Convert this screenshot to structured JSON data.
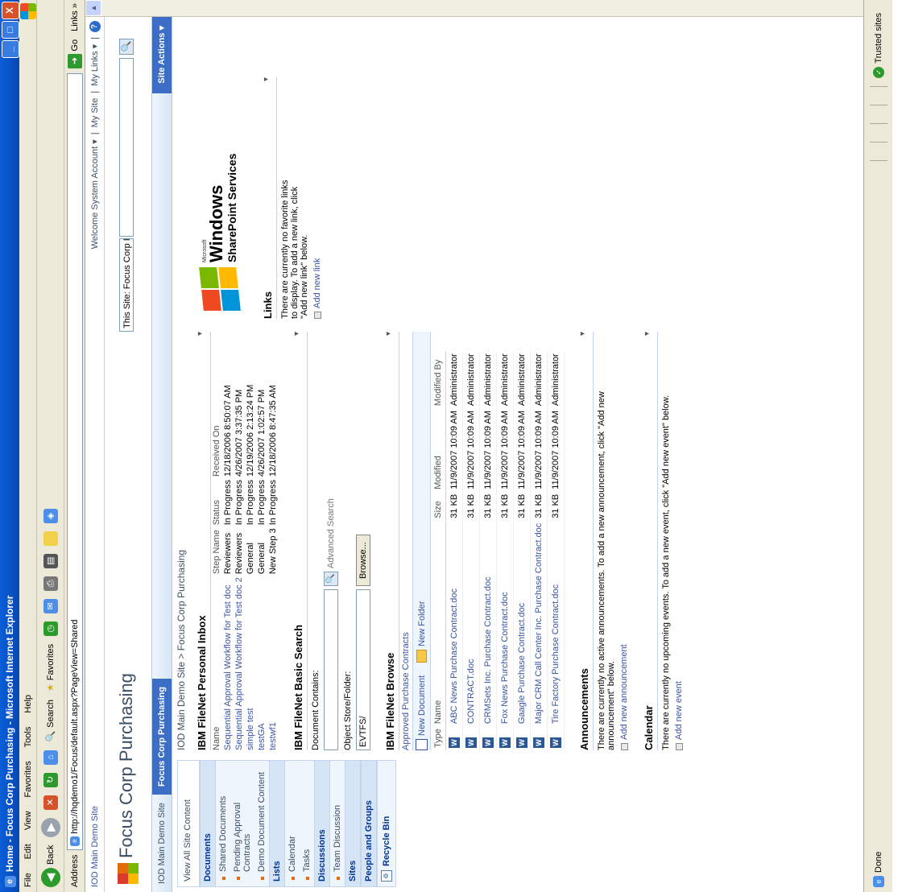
{
  "window": {
    "title": "Home - Focus Corp Purchasing - Microsoft Internet Explorer",
    "min": "_",
    "max": "□",
    "close": "X"
  },
  "menu": [
    "File",
    "Edit",
    "View",
    "Favorites",
    "Tools",
    "Help"
  ],
  "toolbar": {
    "back_label": "Back",
    "search_label": "Search",
    "favorites_label": "Favorites"
  },
  "address": {
    "label": "Address",
    "url": "http://hqdemo1/Focus/default.aspx?PageView=Shared",
    "go_label": "Go",
    "links_label": "Links",
    "links_more": "»"
  },
  "status": {
    "text": "Done",
    "zone": "Trusted sites"
  },
  "sharepoint": {
    "top_site": "IOD Main Demo Site",
    "welcome": "Welcome System Account ▾",
    "my_site": "My Site",
    "my_links": "My Links ▾",
    "sep": "|",
    "help_glyph": "?",
    "site_title": "Focus Corp Purchasing",
    "search_scope": "This Site: Focus Corp Purchasir ▾",
    "search_glyph": "🔍",
    "nav_tabs": [
      {
        "label": "IOD Main Demo Site"
      },
      {
        "label": "Focus Corp Purchasing"
      }
    ],
    "site_actions": "Site Actions ▾",
    "breadcrumb": "IOD Main Demo Site > Focus Corp Purchasing",
    "quicklaunch": {
      "view_all": "View All Site Content",
      "documents_head": "Documents",
      "documents": [
        "Shared Documents",
        "Pending Approval Contracts",
        "Demo Document Content"
      ],
      "lists_head": "Lists",
      "lists": [
        "Calendar",
        "Tasks"
      ],
      "discussions_head": "Discussions",
      "discussions": [
        "Team Discussion"
      ],
      "sites_head": "Sites",
      "people_head": "People and Groups",
      "recycle": "Recycle Bin"
    },
    "caret": "▾",
    "inbox": {
      "title": "IBM FileNet Personal Inbox",
      "headers": [
        "Name",
        "Step Name",
        "Status",
        "Received On"
      ],
      "rows": [
        [
          "Sequential Approval Workflow for Test doc",
          "Reviewers",
          "In Progress",
          "12/18/2006 8:50:07 AM"
        ],
        [
          "Sequential Approval Workflow for Test doc 2",
          "Reviewers",
          "In Progress",
          "4/26/2007 3:37:35 PM"
        ],
        [
          "simple test",
          "General",
          "In Progress",
          "12/19/2006 2:13:24 PM"
        ],
        [
          "testGA",
          "General",
          "In Progress",
          "4/26/2007 1:02:57 PM"
        ],
        [
          "testwf1",
          "New Step 3",
          "In Progress",
          "12/18/2006 8:47:35 AM"
        ]
      ]
    },
    "basic_search": {
      "title": "IBM FileNet Basic Search",
      "doc_contains": "Document Contains:",
      "advanced": "Advanced Search",
      "object_store": "Object Store/Folder:",
      "object_store_value": "EVTFS/",
      "browse": "Browse..."
    },
    "browse": {
      "title": "IBM FileNet Browse",
      "subtitle": "Approved Purchase Contracts",
      "new_document": "New Document",
      "new_folder": "New Folder",
      "headers": [
        "Type",
        "Name",
        "Size",
        "Modified",
        "Modified By"
      ],
      "word_glyph": "W",
      "rows": [
        [
          "ABC News Purchase Contract.doc",
          "31 KB",
          "11/9/2007 10:09 AM",
          "Administrator"
        ],
        [
          "CONTRACT.doc",
          "31 KB",
          "11/9/2007 10:09 AM",
          "Administrator"
        ],
        [
          "CRMSets Inc. Purchase Contract.doc",
          "31 KB",
          "11/9/2007 10:09 AM",
          "Administrator"
        ],
        [
          "Fox News Purchase Contract.doc",
          "31 KB",
          "11/9/2007 10:09 AM",
          "Administrator"
        ],
        [
          "Gaagle Purchase Contract.doc",
          "31 KB",
          "11/9/2007 10:09 AM",
          "Administrator"
        ],
        [
          "Major CRM Call Center Inc. Purchase Contract.doc",
          "31 KB",
          "11/9/2007 10:09 AM",
          "Administrator"
        ],
        [
          "Tire Factory Purchase Contract.doc",
          "31 KB",
          "11/9/2007 10:09 AM",
          "Administrator"
        ]
      ]
    },
    "announcements": {
      "title": "Announcements",
      "empty": "There are currently no active announcements. To add a new announcement, click \"Add new announcement\" below.",
      "add": "Add new announcement"
    },
    "calendar": {
      "title": "Calendar",
      "empty": "There are currently no upcoming events. To add a new event, click \"Add new event\" below.",
      "add": "Add new event"
    },
    "logo": {
      "microsoft": "Microsoft",
      "windows": "Windows",
      "sps": "SharePoint Services"
    },
    "links": {
      "title": "Links",
      "empty": "There are currently no favorite links to display. To add a new link, click \"Add new link\" below.",
      "add": "Add new link"
    }
  },
  "colors": {
    "titlebar": "#0a5fd8",
    "nav_active": "#3c6ec5",
    "link": "#3954a5"
  }
}
